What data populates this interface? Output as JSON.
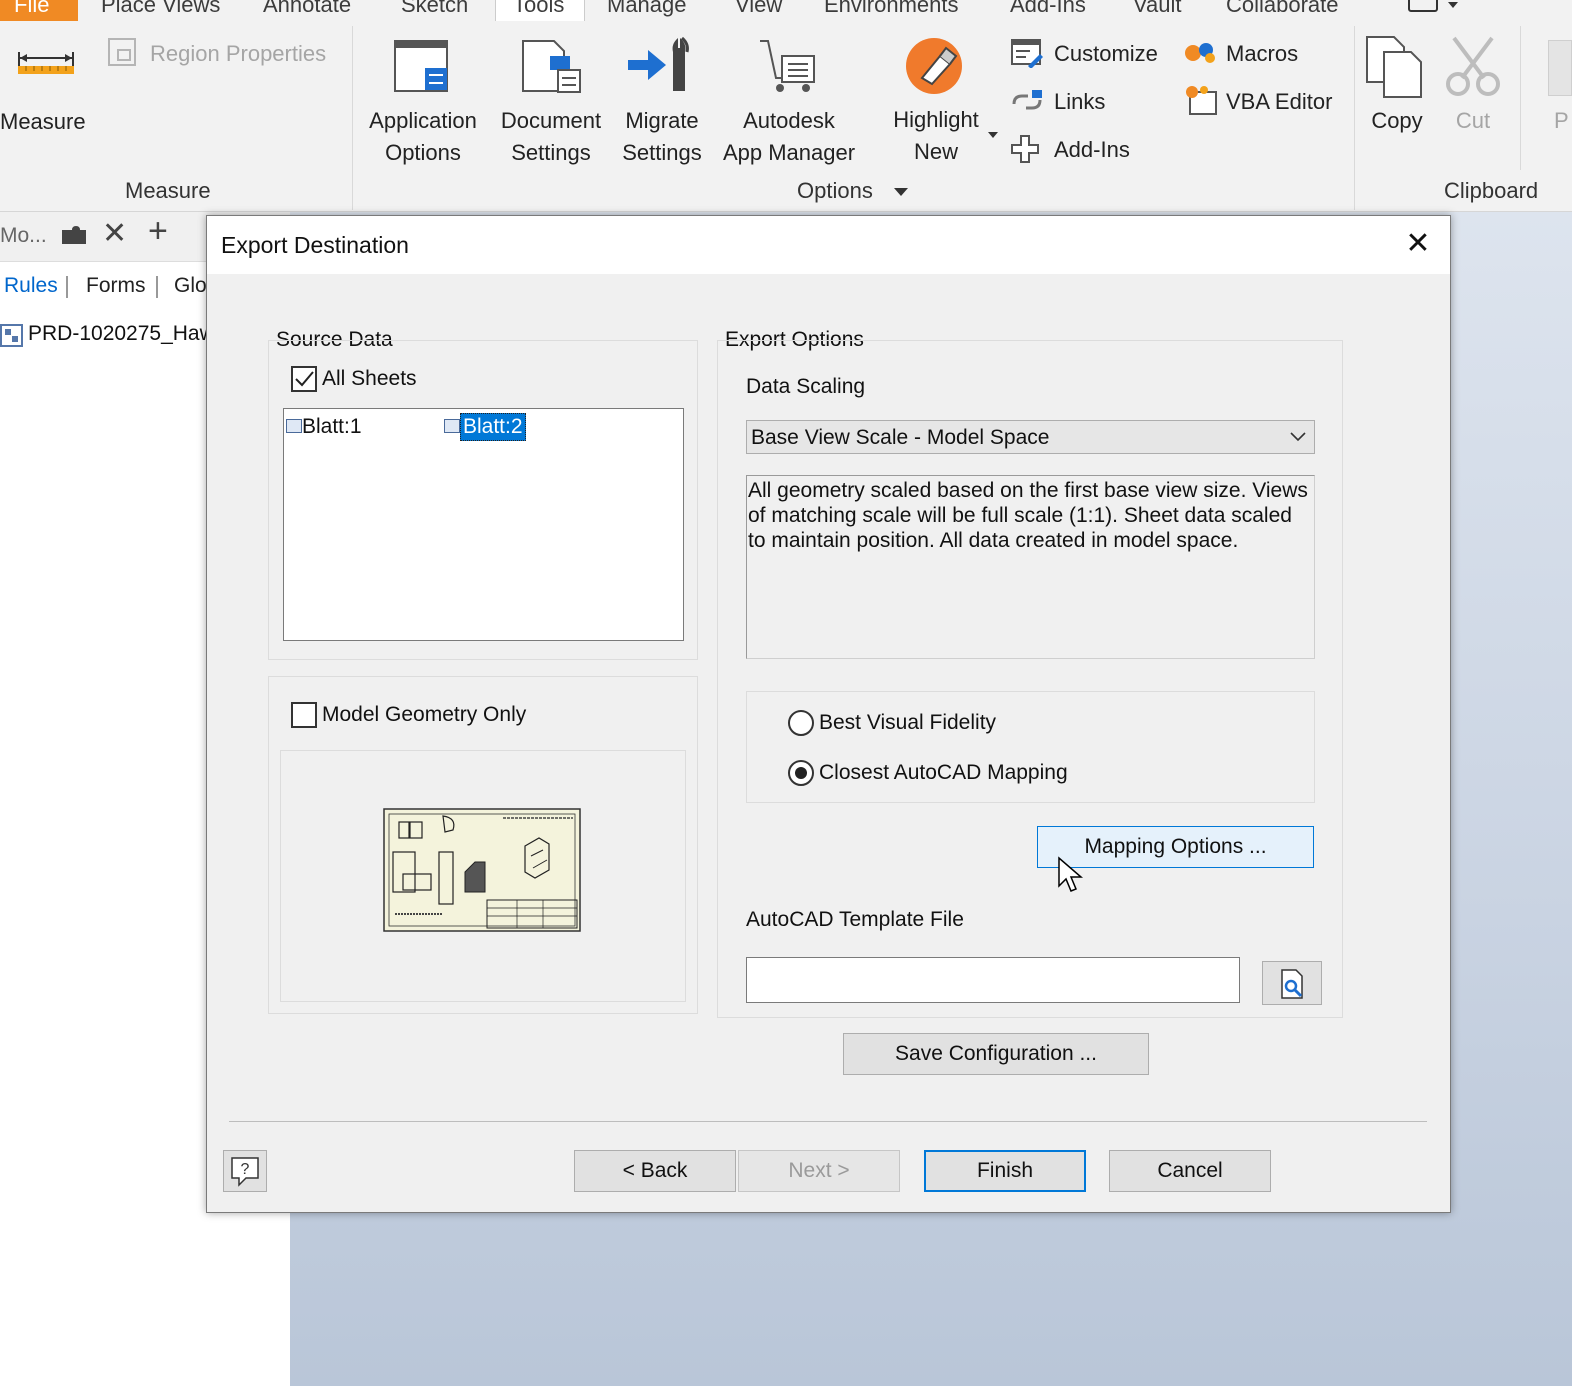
{
  "ribbon": {
    "tabs": [
      "File",
      "Place Views",
      "Annotate",
      "Sketch",
      "Tools",
      "Manage",
      "View",
      "Environments",
      "Add-Ins",
      "Vault",
      "Collaborate"
    ],
    "measure_label": "Measure",
    "region_properties_label": "Region Properties",
    "measure_panel_label": "Measure",
    "application_options": [
      "Application",
      "Options"
    ],
    "document_settings": [
      "Document",
      "Settings"
    ],
    "migrate_settings": [
      "Migrate",
      "Settings"
    ],
    "app_manager": [
      "Autodesk",
      "App Manager"
    ],
    "highlight_new": [
      "Highlight",
      "New"
    ],
    "customize_label": "Customize",
    "links_label": "Links",
    "addins_label": "Add-Ins",
    "macros_label": "Macros",
    "vba_editor_label": "VBA Editor",
    "options_panel_label": "Options",
    "copy_label": "Copy",
    "cut_label": "Cut",
    "paste_partial": "P",
    "clipboard_panel_label": "Clipboard"
  },
  "browser": {
    "tab_label": "Mo...",
    "links": [
      "Rules",
      "Forms",
      "Glo"
    ],
    "tree_item": "PRD-1020275_Haw"
  },
  "dialog": {
    "title": "Export Destination",
    "source_data": {
      "heading": "Source Data",
      "all_sheets_label": "All Sheets",
      "all_sheets_checked": true,
      "sheets": [
        "Blatt:1",
        "Blatt:2"
      ],
      "selected_sheet": "Blatt:2"
    },
    "model_geometry_only_label": "Model Geometry Only",
    "model_geometry_only_checked": false,
    "export_options": {
      "heading": "Export Options",
      "data_scaling_label": "Data Scaling",
      "data_scaling_value": "Base View Scale - Model Space",
      "description": "All geometry scaled based on the first base view size. Views of matching scale will be full scale (1:1). Sheet data scaled to maintain position. All data created in model space.",
      "radio_best_visual": "Best Visual Fidelity",
      "radio_closest_autocad": "Closest AutoCAD Mapping",
      "selected_radio": "Closest AutoCAD Mapping",
      "mapping_options_label": "Mapping Options ...",
      "template_file_label": "AutoCAD Template File",
      "template_file_value": ""
    },
    "save_configuration_label": "Save Configuration ...",
    "back_label": "< Back",
    "next_label": "Next >",
    "finish_label": "Finish",
    "cancel_label": "Cancel"
  },
  "colors": {
    "accent_file_tab": "#f08a24",
    "selection_blue": "#0078d7",
    "link_blue": "#0066cc",
    "hover_button": "#e5f1fb"
  }
}
